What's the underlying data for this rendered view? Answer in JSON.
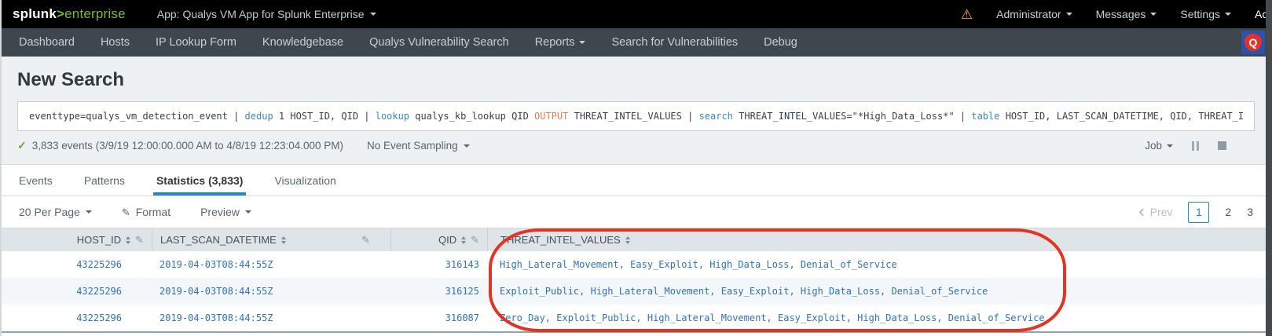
{
  "topbar": {
    "logo": {
      "brand": "splunk",
      "gt": ">",
      "product": "enterprise"
    },
    "app_label": "App: Qualys VM App for Splunk Enterprise",
    "administrator_label": "Administrator",
    "messages_label": "Messages",
    "settings_label": "Settings",
    "activity_label": "Activity"
  },
  "nav": {
    "items": [
      "Dashboard",
      "Hosts",
      "IP Lookup Form",
      "Knowledgebase",
      "Qualys Vulnerability Search",
      "Reports",
      "Search for Vulnerabilities",
      "Debug"
    ],
    "qualys_q": "Q"
  },
  "search": {
    "title": "New Search",
    "query_tokens": [
      {
        "text": "eventtype=qualys_vm_detection_event | ",
        "style": "plain"
      },
      {
        "text": "dedup",
        "style": "command"
      },
      {
        "text": " 1 HOST_ID, QID | ",
        "style": "plain"
      },
      {
        "text": "lookup",
        "style": "command"
      },
      {
        "text": " qualys_kb_lookup QID ",
        "style": "plain"
      },
      {
        "text": "OUTPUT",
        "style": "modifier"
      },
      {
        "text": " THREAT_INTEL_VALUES | ",
        "style": "plain"
      },
      {
        "text": "search",
        "style": "command"
      },
      {
        "text": " THREAT_INTEL_VALUES=\"*High_Data_Loss*\" | ",
        "style": "plain"
      },
      {
        "text": "table",
        "style": "command"
      },
      {
        "text": " HOST_ID, LAST_SCAN_DATETIME, QID, THREAT_INTEL_VALUES",
        "style": "plain"
      }
    ],
    "summary": "3,833 events (3/9/19 12:00:00.000 AM to 4/8/19 12:23:04.000 PM)",
    "sampling_label": "No Event Sampling",
    "job_label": "Job"
  },
  "tabs": [
    {
      "label": "Events",
      "active": false
    },
    {
      "label": "Patterns",
      "active": false
    },
    {
      "label": "Statistics (3,833)",
      "active": true
    },
    {
      "label": "Visualization",
      "active": false
    }
  ],
  "controls": {
    "per_page_label": "20 Per Page",
    "format_label": "Format",
    "preview_label": "Preview"
  },
  "pagination": {
    "prev_label": "Prev",
    "pages": [
      "1",
      "2",
      "3"
    ],
    "active_page": "1"
  },
  "table": {
    "columns": [
      "HOST_ID",
      "LAST_SCAN_DATETIME",
      "QID",
      "THREAT_INTEL_VALUES"
    ],
    "rows": [
      {
        "host_id": "43225296",
        "last_scan": "2019-04-03T08:44:55Z",
        "qid": "316143",
        "threat": "High_Lateral_Movement, Easy_Exploit, High_Data_Loss, Denial_of_Service"
      },
      {
        "host_id": "43225296",
        "last_scan": "2019-04-03T08:44:55Z",
        "qid": "316125",
        "threat": "Exploit_Public, High_Lateral_Movement, Easy_Exploit, High_Data_Loss, Denial_of_Service"
      },
      {
        "host_id": "43225296",
        "last_scan": "2019-04-03T08:44:55Z",
        "qid": "316087",
        "threat": "Zero_Day, Exploit_Public, High_Lateral_Movement, Easy_Exploit, High_Data_Loss, Denial_of_Service"
      }
    ]
  },
  "annotation": {
    "type": "highlight-oval",
    "color": "#e03425",
    "target": "THREAT_INTEL_VALUES column"
  },
  "colors": {
    "topbar_bg": "#000000",
    "navbar_bg": "#3e474e",
    "splunk_green": "#7cb82f",
    "accent_blue": "#2089c9",
    "spl_command_blue": "#3a87c8",
    "spl_modifier_orange": "#ef7a4e",
    "table_value_blue": "#2e73b8",
    "warning_orange": "#f8b332",
    "qualys_badge_blue": "#2d53a6",
    "qualys_shield_red": "#e2332a",
    "success_green": "#65a637"
  }
}
